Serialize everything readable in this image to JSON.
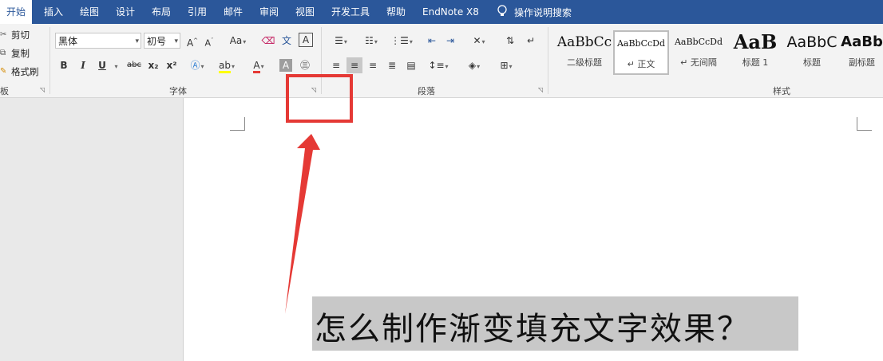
{
  "tabs": [
    {
      "label": "开始",
      "active": true
    },
    {
      "label": "插入"
    },
    {
      "label": "绘图"
    },
    {
      "label": "设计"
    },
    {
      "label": "布局"
    },
    {
      "label": "引用"
    },
    {
      "label": "邮件"
    },
    {
      "label": "审阅"
    },
    {
      "label": "视图"
    },
    {
      "label": "开发工具"
    },
    {
      "label": "帮助"
    },
    {
      "label": "EndNote X8"
    }
  ],
  "tell_me": "操作说明搜索",
  "clipboard": {
    "cut": "剪切",
    "copy": "复制",
    "format_painter": "格式刷",
    "group_label": "板"
  },
  "font": {
    "name": "黑体",
    "size": "初号",
    "group_label": "字体",
    "bold": "B",
    "italic": "I",
    "underline": "U",
    "strike": "abc",
    "subscript": "x₂",
    "superscript": "x²",
    "grow": "A",
    "shrink": "A",
    "case": "Aa",
    "phonetic": "文",
    "border_char": "A"
  },
  "paragraph": {
    "group_label": "段落"
  },
  "styles": {
    "group_label": "样式",
    "items": [
      {
        "preview": "AaBbCc",
        "name": "二级标题"
      },
      {
        "preview": "AaBbCcDd",
        "name": "↵ 正文",
        "selected": true
      },
      {
        "preview": "AaBbCcDd",
        "name": "↵ 无间隔"
      },
      {
        "preview": "AaB",
        "name": "标题 1"
      },
      {
        "preview": "AaBbC",
        "name": "标题"
      },
      {
        "preview": "AaBb",
        "name": "副标题"
      }
    ]
  },
  "caption": "怎么制作渐变填充文字效果？",
  "colors": {
    "accent": "#2b579a",
    "highlight": "#e53935"
  }
}
